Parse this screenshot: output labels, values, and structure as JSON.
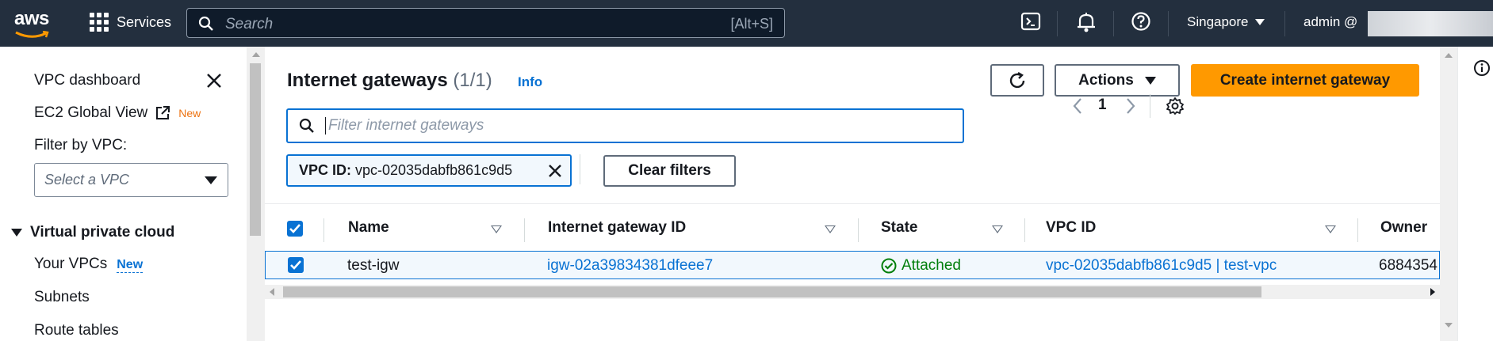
{
  "topnav": {
    "logo_text": "aws",
    "services_label": "Services",
    "search_placeholder": "Search",
    "search_shortcut": "[Alt+S]",
    "region": "Singapore",
    "account": "admin @"
  },
  "sidebar": {
    "vpc_dashboard": "VPC dashboard",
    "ec2_global_view": "EC2 Global View",
    "new_badge": "New",
    "filter_by_vpc_label": "Filter by VPC:",
    "vpc_select_placeholder": "Select a VPC",
    "section_title": "Virtual private cloud",
    "items": [
      {
        "label": "Your VPCs",
        "badge": "New"
      },
      {
        "label": "Subnets"
      },
      {
        "label": "Route tables"
      }
    ]
  },
  "main": {
    "title": "Internet gateways",
    "count": "(1/1)",
    "info_link": "Info",
    "actions_label": "Actions",
    "create_button_label": "Create internet gateway",
    "filter_placeholder": "Filter internet gateways",
    "page_number": "1",
    "filter_token": {
      "key": "VPC ID:",
      "value": "vpc-02035dabfb861c9d5"
    },
    "clear_filters_label": "Clear filters"
  },
  "table": {
    "columns": [
      "Name",
      "Internet gateway ID",
      "State",
      "VPC ID",
      "Owner"
    ],
    "rows": [
      {
        "selected": true,
        "name": "test-igw",
        "igw_id": "igw-02a39834381dfeee7",
        "state": "Attached",
        "vpc_id": "vpc-02035dabfb861c9d5 | test-vpc",
        "owner": "6884354"
      }
    ]
  },
  "colors": {
    "nav_bg": "#232f3e",
    "primary": "#ff9900",
    "link": "#0972d3",
    "success": "#037f0c"
  }
}
